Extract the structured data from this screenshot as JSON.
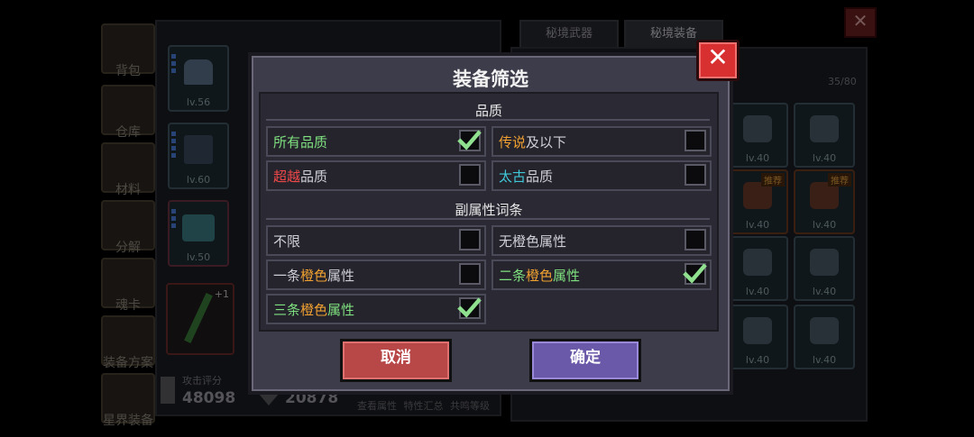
{
  "background": {
    "sidebar": [
      {
        "label": "背包"
      },
      {
        "label": "仓库"
      },
      {
        "label": "材料"
      },
      {
        "label": "分解"
      },
      {
        "label": "魂卡"
      },
      {
        "label": "装备方案"
      },
      {
        "label": "星界装备"
      }
    ],
    "equipped_slots": [
      {
        "level": "lv.56"
      },
      {
        "level": "lv.60"
      },
      {
        "level": "lv.50"
      }
    ],
    "weapon_slot_bonus": "+1",
    "attack_score_label": "攻击评分",
    "attack_score": "48098",
    "defense_score": "20878",
    "bottom_links": [
      "查看属性",
      "特性汇总",
      "共鸣等级"
    ],
    "tabs": [
      "秘境武器",
      "秘境装备"
    ],
    "capacity": "35/80",
    "recommend_badge": "推荐",
    "grid_levels": [
      "lv.40",
      "lv.40",
      "lv.40",
      "lv.40",
      "lv.40",
      "lv.40",
      "lv.40",
      "lv.40"
    ]
  },
  "modal": {
    "title": "装备筛选",
    "close_label": "✕",
    "quality": {
      "title": "品质",
      "options": [
        {
          "parts": [
            {
              "t": "所有品质",
              "c": "green"
            }
          ],
          "checked": true
        },
        {
          "parts": [
            {
              "t": "传说",
              "c": "orange"
            },
            {
              "t": "及以下",
              "c": "plain"
            }
          ],
          "checked": false
        },
        {
          "parts": [
            {
              "t": "超越",
              "c": "red"
            },
            {
              "t": "品质",
              "c": "plain"
            }
          ],
          "checked": false
        },
        {
          "parts": [
            {
              "t": "太古",
              "c": "cyan"
            },
            {
              "t": "品质",
              "c": "plain"
            }
          ],
          "checked": false
        }
      ]
    },
    "affix": {
      "title": "副属性词条",
      "options": [
        {
          "parts": [
            {
              "t": "不限",
              "c": "plain"
            }
          ],
          "checked": false
        },
        {
          "parts": [
            {
              "t": "无橙色属性",
              "c": "plain"
            }
          ],
          "checked": false
        },
        {
          "parts": [
            {
              "t": "一条",
              "c": "plain"
            },
            {
              "t": "橙色",
              "c": "orange"
            },
            {
              "t": "属性",
              "c": "plain"
            }
          ],
          "checked": false
        },
        {
          "parts": [
            {
              "t": "二条",
              "c": "green"
            },
            {
              "t": "橙色",
              "c": "orange"
            },
            {
              "t": "属性",
              "c": "green"
            }
          ],
          "checked": true
        },
        {
          "parts": [
            {
              "t": "三条",
              "c": "green"
            },
            {
              "t": "橙色",
              "c": "orange"
            },
            {
              "t": "属性",
              "c": "green"
            }
          ],
          "checked": true
        }
      ]
    },
    "cancel_label": "取消",
    "confirm_label": "确定"
  },
  "colors": {
    "green": "#7ee07e",
    "orange": "#f0a030",
    "red": "#f04848",
    "cyan": "#40c8d8",
    "plain": "#cfcfd6"
  }
}
